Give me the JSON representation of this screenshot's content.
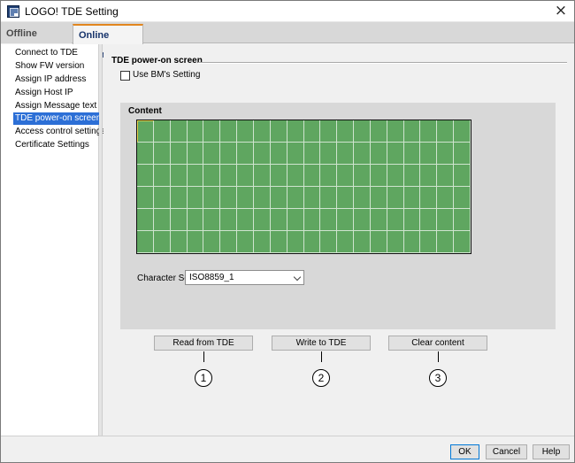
{
  "window": {
    "title": "LOGO! TDE Setting",
    "close_glyph": "×"
  },
  "tabs": [
    {
      "label": "Offline settings",
      "active": false
    },
    {
      "label": "Online settings",
      "active": true
    }
  ],
  "sidebar": {
    "items": [
      {
        "label": "Connect to TDE",
        "selected": false
      },
      {
        "label": "Show FW version",
        "selected": false
      },
      {
        "label": "Assign IP address",
        "selected": false
      },
      {
        "label": "Assign Host IP",
        "selected": false
      },
      {
        "label": "Assign Message text",
        "selected": false
      },
      {
        "label": "TDE power-on screen",
        "selected": true
      },
      {
        "label": "Access control settings",
        "selected": false
      },
      {
        "label": "Certificate Settings",
        "selected": false
      }
    ]
  },
  "main": {
    "section_title": "TDE power-on screen",
    "use_bm_setting": {
      "label": "Use BM's Setting",
      "checked": false
    },
    "content": {
      "title": "Content",
      "grid": {
        "columns": 20,
        "rows": 6,
        "cursor_cell": [
          0,
          0
        ],
        "color": "#5fa660"
      },
      "character_set": {
        "label": "Character Set:",
        "value": "ISO8859_1"
      }
    },
    "actions": {
      "read": "Read from TDE",
      "write": "Write to TDE",
      "clear": "Clear content"
    },
    "callouts": [
      "1",
      "2",
      "3"
    ]
  },
  "footer": {
    "ok": "OK",
    "cancel": "Cancel",
    "help": "Help"
  },
  "colors": {
    "accent_tab": "#e2861f",
    "selection": "#2c6fd6",
    "lcd_green": "#5fa660"
  }
}
